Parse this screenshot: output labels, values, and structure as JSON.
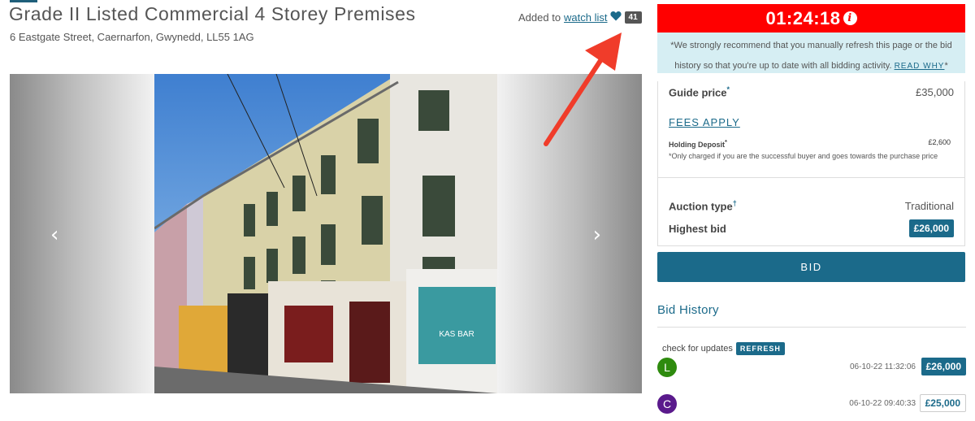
{
  "listing": {
    "title": "Grade II Listed Commercial 4 Storey Premises",
    "address": "6 Eastgate Street, Caernarfon, Gwynedd, LL55 1AG"
  },
  "watchlist": {
    "prefix": "Added to",
    "link_label": "watch list",
    "count": "41",
    "icon": "heart-icon"
  },
  "gallery": {
    "prev_icon": "chevron-left-icon",
    "next_icon": "chevron-right-icon",
    "prev_glyph": "‹",
    "next_glyph": "›"
  },
  "auction": {
    "timer": "01:24:18",
    "timer_color": "#ff0000",
    "notice": "*We strongly recommend that you manually refresh this page or the bid history so that you're up to date with all bidding activity.",
    "read_why": "READ WHY",
    "read_why_suffix": "*",
    "guide_price_label": "Guide price",
    "guide_price_marker": "*",
    "guide_price": "£35,000",
    "fees_label": "FEES APPLY",
    "holding_deposit_label": "Holding Deposit",
    "holding_deposit_marker": "*",
    "holding_deposit": "£2,600",
    "holding_deposit_note": "*Only charged if you are the successful buyer and goes towards the purchase price",
    "auction_type_label": "Auction type",
    "auction_type_marker": "†",
    "auction_type": "Traditional",
    "highest_bid_label": "Highest bid",
    "highest_bid": "£26,000",
    "bid_button": "BID",
    "accent_color": "#1b6a8a"
  },
  "bid_history": {
    "title": "Bid History",
    "updates_text": "check for updates",
    "refresh_label": "REFRESH",
    "bids": [
      {
        "initial": "L",
        "color": "#2e8b0e",
        "timestamp": "06-10-22 11:32:06",
        "amount": "£26,000"
      },
      {
        "initial": "C",
        "color": "#5a1a8c",
        "timestamp": "06-10-22 09:40:33",
        "amount": "£25,000"
      }
    ]
  }
}
